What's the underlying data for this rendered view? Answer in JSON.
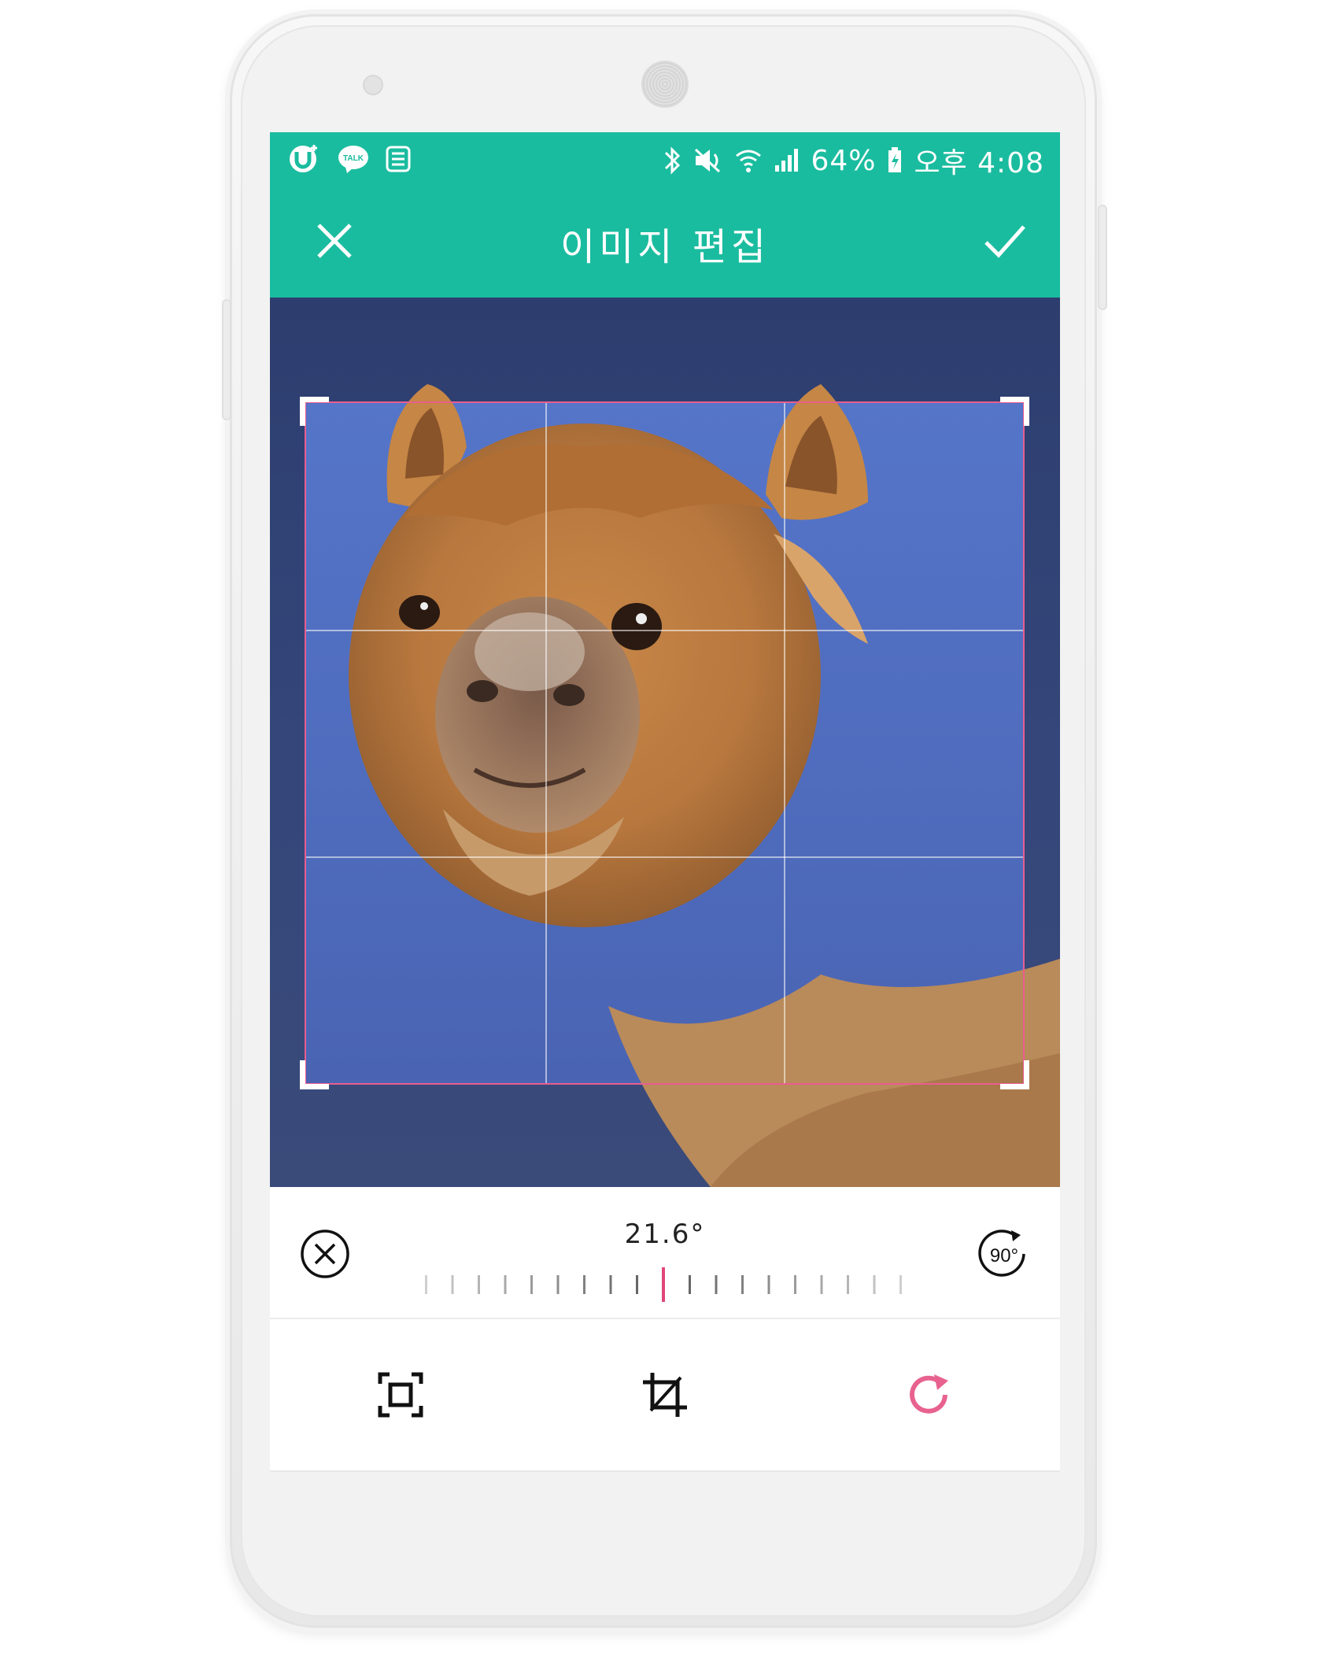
{
  "status_bar": {
    "left_icons": [
      "u-plus-icon",
      "kakaotalk-icon",
      "message-icon"
    ],
    "kakao_label": "TALK",
    "right_icons": [
      "bluetooth-icon",
      "mute-icon",
      "wifi-icon",
      "signal-icon",
      "battery-charging-icon"
    ],
    "battery": "64%",
    "time": "오후 4:08"
  },
  "app_bar": {
    "title": "이미지 편집",
    "close_icon": "close-icon",
    "confirm_icon": "check-icon"
  },
  "crop": {
    "grid": "3x3",
    "frame_color": "#ea5d8f"
  },
  "rotation": {
    "angle": "21.6°",
    "reset_icon": "circle-x-icon",
    "rotate90_label": "90°",
    "indicator_color": "#e0457b"
  },
  "toolbar": {
    "tools": [
      {
        "name": "aspect-ratio",
        "icon": "fit-frame-icon",
        "active": false
      },
      {
        "name": "crop",
        "icon": "crop-icon",
        "active": false
      },
      {
        "name": "rotate",
        "icon": "rotate-icon",
        "active": true
      }
    ],
    "active_color": "#e8628f"
  },
  "colors": {
    "primary": "#1abc9f",
    "sky": "#4a6bb8"
  }
}
